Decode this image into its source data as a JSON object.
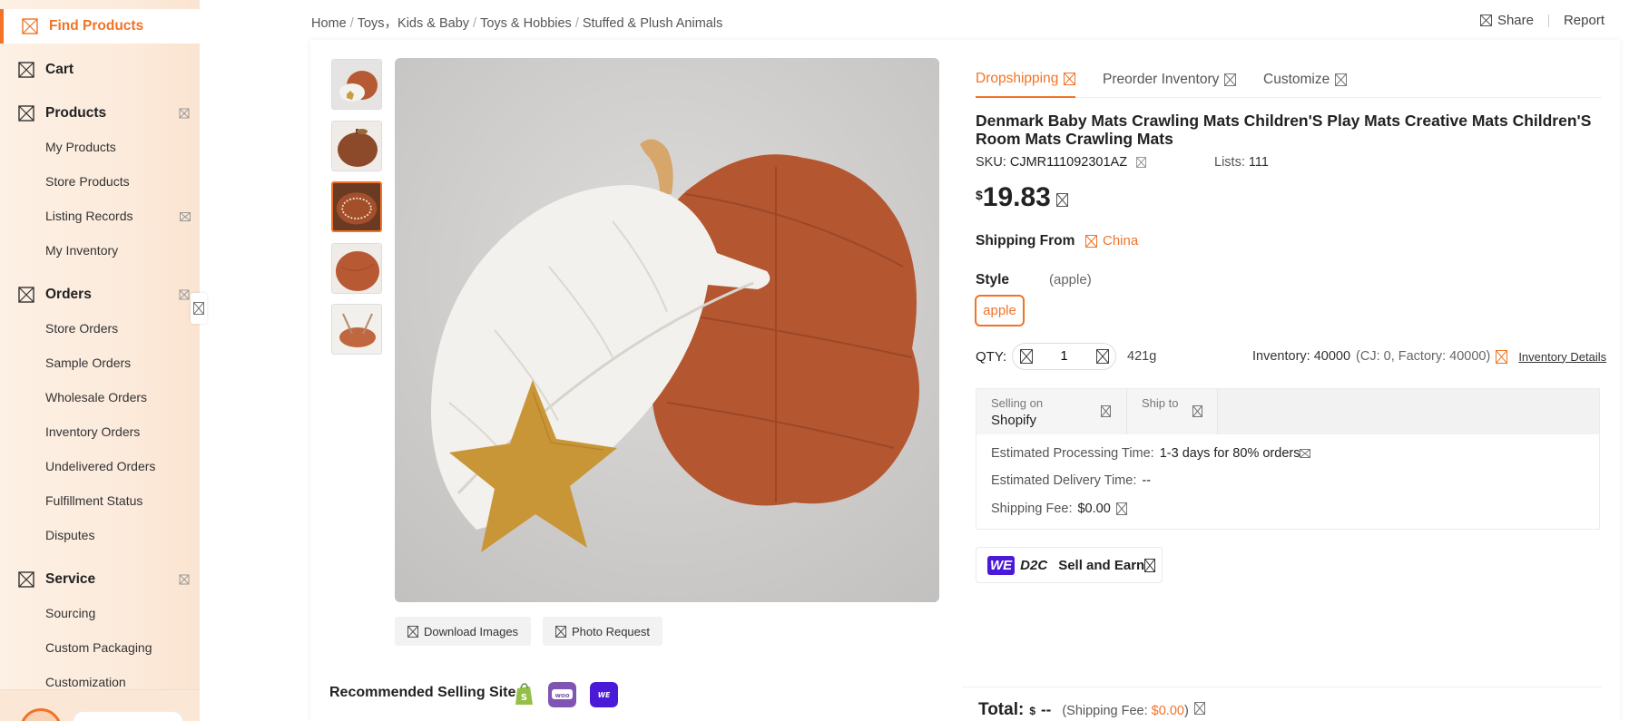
{
  "sidebar": {
    "find_products": "Find Products",
    "cart": "Cart",
    "products": "Products",
    "products_items": [
      "My Products",
      "Store Products",
      "Listing Records",
      "My Inventory"
    ],
    "orders": "Orders",
    "orders_items": [
      "Store Orders",
      "Sample Orders",
      "Wholesale Orders",
      "Inventory Orders",
      "Undelivered Orders",
      "Fulfillment Status",
      "Disputes"
    ],
    "service": "Service",
    "service_items": [
      "Sourcing",
      "Custom Packaging",
      "Customization"
    ]
  },
  "breadcrumb": {
    "home": "Home",
    "level1": "Toys，Kids & Baby",
    "level2": "Toys & Hobbies",
    "level3": "Stuffed & Plush Animals",
    "sep": "/"
  },
  "top_actions": {
    "share": "Share",
    "report": "Report"
  },
  "gallery": {
    "download_images": "Download Images",
    "photo_request": "Photo Request",
    "selected_thumb": 3
  },
  "recommended": {
    "label": "Recommended Selling Site",
    "sites": [
      "shopify-icon",
      "woocommerce-icon",
      "wed2c-icon"
    ]
  },
  "tabs": [
    "Dropshipping",
    "Preorder Inventory",
    "Customize"
  ],
  "product": {
    "title": "Denmark Baby Mats Crawling Mats Children'S Play Mats Creative Mats Children'S Room Mats Crawling Mats",
    "sku_label": "SKU:",
    "sku": "CJMR111092301AZ",
    "lists_label": "Lists:",
    "lists": "111",
    "price_currency": "$",
    "price": "19.83",
    "shipping_from_label": "Shipping From",
    "shipping_from": "China",
    "style_label": "Style",
    "style_selected": "(apple)",
    "style_option": "apple",
    "qty_label": "QTY:",
    "qty": "1",
    "weight": "421g",
    "inventory": "Inventory: 40000",
    "inventory_breakdown": "(CJ: 0, Factory: 40000)",
    "inventory_details": "Inventory Details"
  },
  "shipping": {
    "selling_on_label": "Selling on",
    "selling_on": "Shopify",
    "ship_to_label": "Ship to",
    "processing_label": "Estimated Processing Time:",
    "processing": "1-3 days for 80% orders",
    "delivery_label": "Estimated Delivery Time:",
    "delivery": "--",
    "fee_label": "Shipping Fee:",
    "fee": "$0.00"
  },
  "wed2c": {
    "we": "WE",
    "d2c": "D2C",
    "cta": "Sell and Earn"
  },
  "total": {
    "label": "Total:",
    "currency": "$",
    "amount": "--",
    "fee_prefix": "(Shipping Fee: ",
    "fee": "$0.00",
    "fee_suffix": ")"
  },
  "colors": {
    "accent": "#f27327",
    "wed2c_purple": "#4b19d8"
  }
}
